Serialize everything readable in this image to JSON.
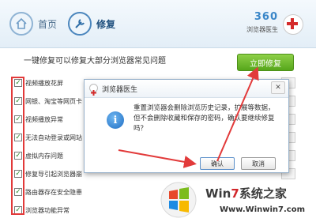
{
  "nav": {
    "home_label": "首页",
    "repair_label": "修复"
  },
  "brand": {
    "number": "360",
    "name": "浏览器医生"
  },
  "main": {
    "headline": "一键修复可以修复大部分浏览器常见问题",
    "fix_button": "立即修复"
  },
  "items": [
    "视频播放花屏",
    "网银、淘宝等网页卡",
    "视频播放异常",
    "无法自动登录或网站",
    "虚拟内存问题",
    "修复导引起浏览器崩",
    "路由器存在安全隐患",
    "浏览器功能异常"
  ],
  "dialog": {
    "title": "浏览器医生",
    "close_symbol": "✕",
    "message": "重置浏览器会删除浏览历史记录，扩展等数据，但不会删除收藏和保存的密码，确认要继续修复吗？",
    "ok_label": "确认",
    "cancel_label": "取消"
  },
  "watermark": {
    "brand_part1": "Win",
    "brand_part2": "7",
    "brand_part3": "系统之家",
    "url": "Www.Winwin7.com"
  },
  "colors": {
    "accent_green": "#56a61b",
    "annotation_red": "#e23a3a",
    "info_blue": "#1f6ec4"
  }
}
